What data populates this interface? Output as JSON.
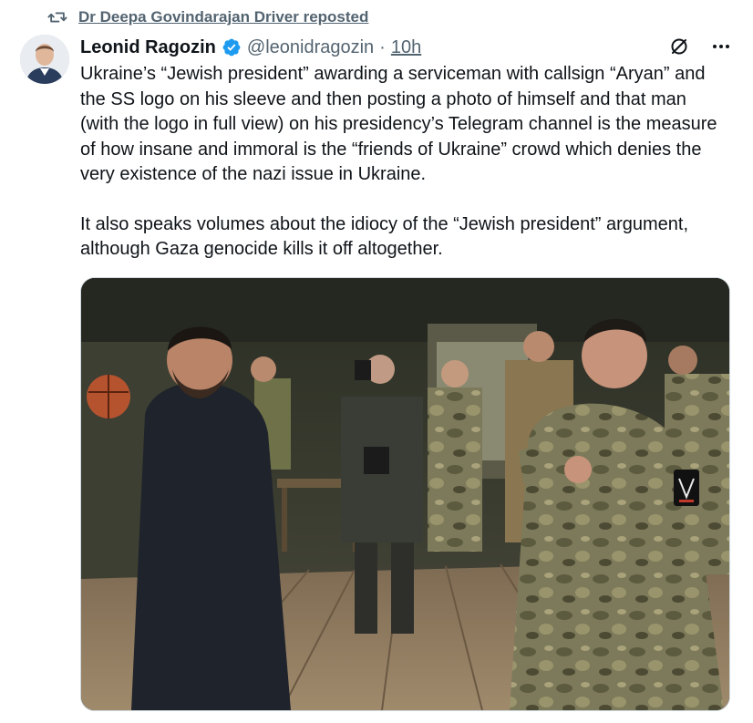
{
  "repost": {
    "label": "Dr Deepa Govindarajan Driver reposted"
  },
  "author": {
    "name": "Leonid Ragozin",
    "handle": "@leonidragozin",
    "separator": "·",
    "time": "10h"
  },
  "tweet": {
    "paragraph1": "Ukraine’s “Jewish president” awarding a serviceman with callsign “Aryan” and the SS logo on his sleeve and then posting a photo of himself and that man (with the logo in full view) on his presidency’s Telegram channel is the measure of how insane and immoral is the “friends of Ukraine” crowd which denies the very existence of the nazi issue in Ukraine.",
    "paragraph2": "It also speaks volumes about the idiocy of the “Jewish president” argument, although Gaza genocide kills it off altogether."
  },
  "icons": {
    "repost": "repost-icon",
    "verified": "verified-badge-icon",
    "grok": "grok-icon",
    "more": "more-icon"
  },
  "colors": {
    "secondary_text": "#536471",
    "verified_blue": "#1d9bf0",
    "border": "#cfd9de"
  }
}
